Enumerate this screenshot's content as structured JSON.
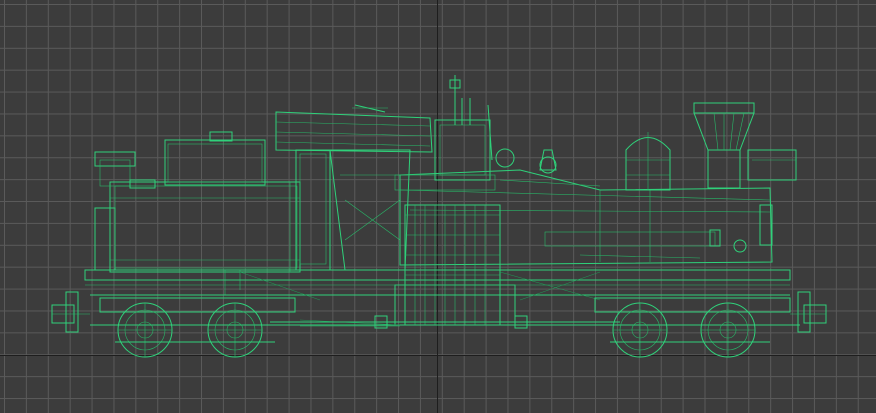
{
  "viewport": {
    "name": "front-viewport",
    "grid": true,
    "background_color": "#3c3c3c",
    "grid_color": "#5a5a5a",
    "axis_color": "#1e1e1e"
  },
  "model": {
    "display_mode": "wireframe",
    "wire_color": "#2fd17a",
    "subject": "shay-geared-steam-locomotive"
  }
}
